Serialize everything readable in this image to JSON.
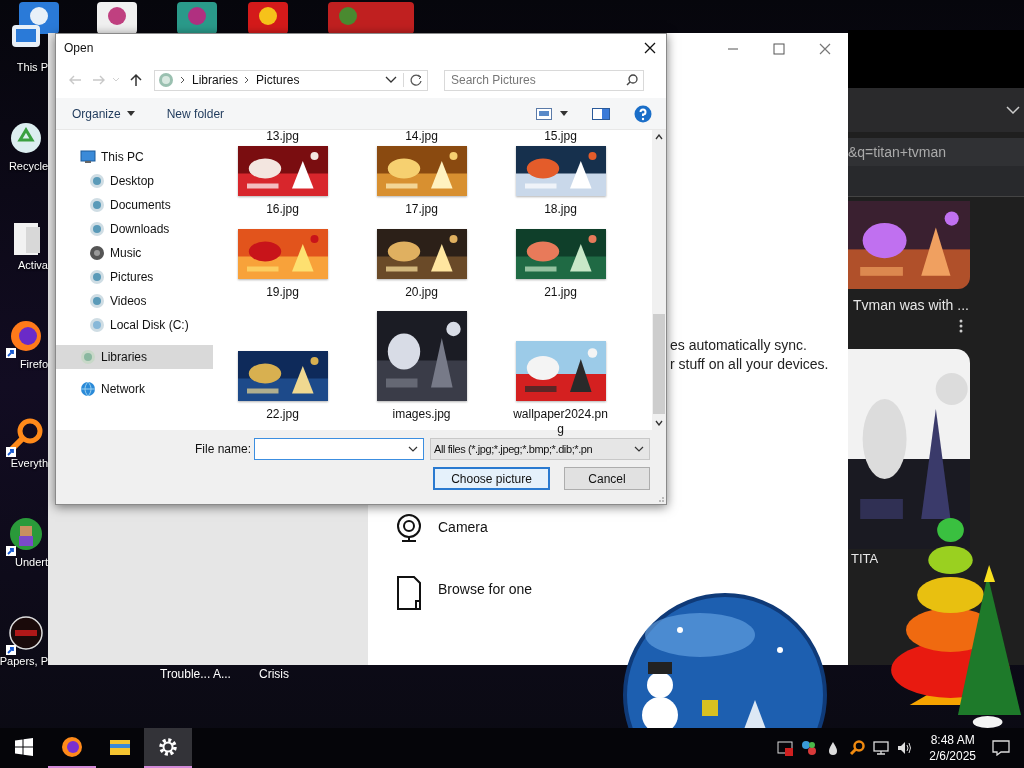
{
  "desktop": {
    "icons": [
      {
        "label": "This P",
        "shortcut": false,
        "kind": "pc"
      },
      {
        "label": "Recycle",
        "shortcut": false,
        "kind": "recycle"
      },
      {
        "label": "Activa",
        "shortcut": false,
        "kind": "folder"
      },
      {
        "label": "Firefo",
        "shortcut": true,
        "kind": "browser"
      },
      {
        "label": "Everyth",
        "shortcut": true,
        "kind": "search"
      },
      {
        "label": "Undert",
        "shortcut": true,
        "kind": "game"
      },
      {
        "label": "Papers, P",
        "shortcut": true,
        "kind": "stamp"
      }
    ],
    "bottom_icons": [
      {
        "label": "Trouble... A..."
      },
      {
        "label": "Crisis"
      }
    ]
  },
  "settings_window": {
    "sync_text": [
      "es automatically sync.",
      "r stuff on all your devices."
    ],
    "options": [
      {
        "kind": "camera",
        "label": "Camera"
      },
      {
        "kind": "browse",
        "label": "Browse for one"
      }
    ]
  },
  "browser": {
    "address": "&q=titan+tvman",
    "cards": [
      {
        "title": "Tvman was with ..."
      },
      {
        "title": "TITA"
      }
    ]
  },
  "dialog": {
    "title": "Open",
    "path": [
      "Libraries",
      "Pictures"
    ],
    "search": {
      "placeholder": "Search Pictures"
    },
    "toolbar": [
      "Organize",
      "New folder"
    ],
    "nav": [
      {
        "label": "This PC",
        "kind": "pc",
        "selected": false,
        "children": [
          {
            "label": "Desktop",
            "kind": "folder",
            "selected": false
          },
          {
            "label": "Documents",
            "kind": "folder",
            "selected": false
          },
          {
            "label": "Downloads",
            "kind": "folder",
            "selected": false
          },
          {
            "label": "Music",
            "kind": "music",
            "selected": false
          },
          {
            "label": "Pictures",
            "kind": "folder",
            "selected": false
          },
          {
            "label": "Videos",
            "kind": "folder",
            "selected": false
          },
          {
            "label": "Local Disk (C:)",
            "kind": "disk",
            "selected": false
          }
        ]
      },
      {
        "label": "Libraries",
        "kind": "library",
        "selected": true
      },
      {
        "label": "Network",
        "kind": "network",
        "selected": false
      }
    ],
    "files_cut": [
      "13.jpg",
      "14.jpg",
      "15.jpg"
    ],
    "files": [
      {
        "name": "16.jpg"
      },
      {
        "name": "17.jpg"
      },
      {
        "name": "18.jpg"
      },
      {
        "name": "19.jpg"
      },
      {
        "name": "20.jpg"
      },
      {
        "name": "21.jpg"
      },
      {
        "name": "22.jpg"
      },
      {
        "name": "images.jpg"
      },
      {
        "name": "wallpaper2024.png"
      }
    ],
    "file_name_label": "File name:",
    "filter": "All files (*.jpg;*.jpeg;*.bmp;*.dib;*.pn",
    "buttons": [
      {
        "label": "Choose picture",
        "default": true
      },
      {
        "label": "Cancel",
        "default": false
      }
    ]
  },
  "taskbar": {
    "apps": [
      {
        "kind": "browser",
        "running": true,
        "active": false
      },
      {
        "kind": "folder",
        "running": false,
        "active": false
      },
      {
        "kind": "gear",
        "running": true,
        "active": true
      }
    ],
    "time": "8:48 AM",
    "date": "2/6/2025"
  }
}
